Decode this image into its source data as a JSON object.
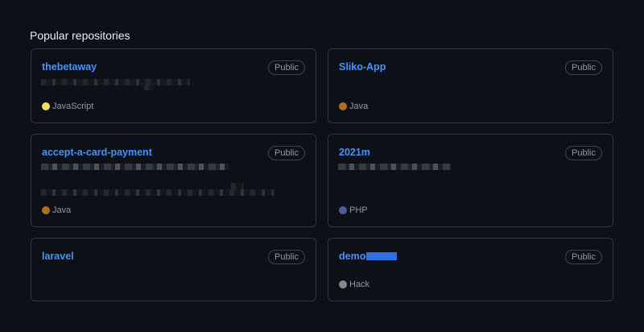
{
  "section": {
    "title": "Popular repositories"
  },
  "repos": [
    {
      "name": "thebetaway",
      "visibility": "Public",
      "language": "JavaScript",
      "language_color": "#f1e05a"
    },
    {
      "name": "Sliko-App",
      "visibility": "Public",
      "language": "Java",
      "language_color": "#b07219"
    },
    {
      "name": "accept-a-card-payment",
      "visibility": "Public",
      "language": "Java",
      "language_color": "#b07219"
    },
    {
      "name": "2021m",
      "visibility": "Public",
      "language": "PHP",
      "language_color": "#4F5D95"
    },
    {
      "name": "laravel",
      "visibility": "Public"
    },
    {
      "name": "demo",
      "visibility": "Public",
      "language": "Hack",
      "language_color": "#878787"
    }
  ]
}
